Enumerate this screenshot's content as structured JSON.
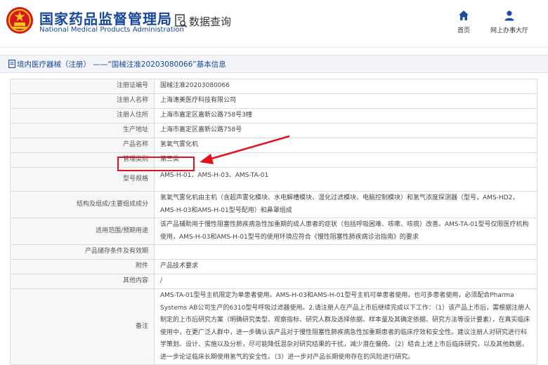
{
  "header": {
    "brand_cn": "国家药品监督管理局",
    "brand_en": "National Medical Products Administration",
    "query_label": "数据查询",
    "nav": [
      {
        "label": "首页",
        "icon": "home-icon"
      },
      {
        "label": "网上办事大厅",
        "icon": "user-icon"
      }
    ]
  },
  "title_bar": {
    "text": "境内医疗器械（注册） ——“国械注准20203080066”基本信息"
  },
  "table": {
    "rows": [
      {
        "label": "注册证编号",
        "value": "国械注准20203080066"
      },
      {
        "label": "注册人名称",
        "value": "上海潓美医疗科技有限公司"
      },
      {
        "label": "注册人住所",
        "value": "上海市嘉定区嘉新公路758号3幢"
      },
      {
        "label": "生产地址",
        "value": "上海市嘉定区嘉新公路758号"
      },
      {
        "label": "产品名称",
        "value": "氢氧气雾化机"
      },
      {
        "label": "管理类别",
        "value": "第三类"
      },
      {
        "label": "型号规格",
        "value": "AMS-H-01、AMS-H-03、AMS-TA-01"
      },
      {
        "label": "结构及组成/主要组成成分",
        "value": "氢氧气雾化机由主机（含超声雾化模块、水电解槽模块、湿化过滤模块、电脑控制模块）和氢气浓度探测器（型号，AMS-HD2，AMS-H-03和AMS-H-01型号配用）和鼻罩组成"
      },
      {
        "label": "适用范围/预期用途",
        "value": "该产品辅助用于慢性阻塞性肺疾病急性加重期的成人患者的症状（包括呼吸困难、咳嗽、咳痰）改善。AMS-TA-01型号仅限医疗机构使用，AMS-H-03和AMS-H-01型号的使用环境应符合《慢性阻塞性肺疾病诊治指南》的要求"
      },
      {
        "label": "产品储存条件及有效期",
        "value": ""
      },
      {
        "label": "附件",
        "value": "产品技术要求"
      },
      {
        "label": "其他内容",
        "value": "/"
      },
      {
        "label": "备注",
        "value": "AMS-TA-01型号主机限定为单患者使用。AMS-H-03和AMS-H-01型号主机可单患者使用，也可多患者使用，必须配合Pharma Systems AB公司生产的6310型号呼吸过滤器使用。2.请注册人在产品上市后继续完成以下工作：（1）该产品上市后，需根据注册人制定的上市后研究方案（明确研究类型、观察指标、研究人群及选择依据、样本量及其确定依据、研究方法等设计要素），在真实临床使用中，在更广泛人群中，进一步确认该产品对于慢性阻塞性肺疾病急性加重期患者的临床疗效和安全性。建议注册人对研究进行科学策划、设计、实施以及分析，尽可能降低混杂对研究结果的干扰，减少潜在偏倚。（2）结合上述上市后临床研究，以及其他数据，进一步论证临床长期使用氢气的安全性。（3）进一步对产品长期使用存在的风险进行研究。"
      }
    ]
  },
  "colors": {
    "brand": "#17489a",
    "highlight": "#e3121c"
  }
}
